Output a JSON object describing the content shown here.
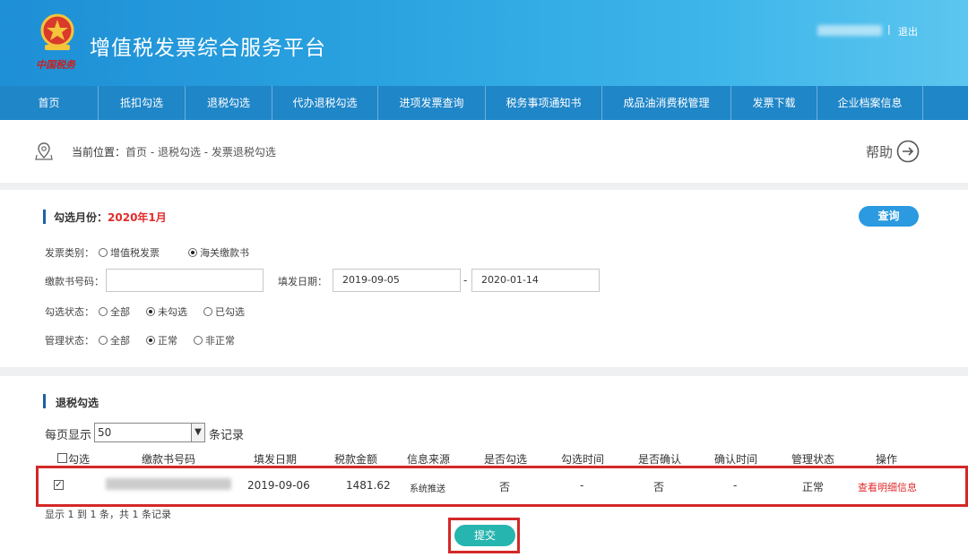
{
  "header": {
    "logo_text": "中国税务",
    "title": "增值税发票综合服务平台",
    "separator": "|",
    "logout": "退出"
  },
  "nav": {
    "items": [
      {
        "label": "首页"
      },
      {
        "label": "抵扣勾选"
      },
      {
        "label": "退税勾选"
      },
      {
        "label": "代办退税勾选"
      },
      {
        "label": "进项发票查询"
      },
      {
        "label": "税务事项通知书"
      },
      {
        "label": "成品油消费税管理"
      },
      {
        "label": "发票下载"
      },
      {
        "label": "企业档案信息"
      }
    ]
  },
  "breadcrumb": {
    "label": "当前位置：",
    "path": "首页 - 退税勾选 - 发票退税勾选",
    "help": "帮助"
  },
  "filter": {
    "month_label": "勾选月份：",
    "month_value": "2020年1月",
    "query_button": "查询",
    "invoice_type_label": "发票类别：",
    "invoice_type_options": [
      "增值税发票",
      "海关缴款书"
    ],
    "invoice_type_selected": "海关缴款书",
    "payment_no_label": "缴款书号码：",
    "payment_no_value": "",
    "issue_date_label": "填发日期：",
    "date_from": "2019-09-05",
    "date_sep": "-",
    "date_to": "2020-01-14",
    "check_status_label": "勾选状态：",
    "check_status_options": [
      "全部",
      "未勾选",
      "已勾选"
    ],
    "check_status_selected": "未勾选",
    "manage_status_label": "管理状态：",
    "manage_status_options": [
      "全部",
      "正常",
      "非正常"
    ],
    "manage_status_selected": "正常"
  },
  "table_section": {
    "title": "退税勾选",
    "per_page_label": "每页显示",
    "per_page_value": "50",
    "records_label": "条记录",
    "columns": [
      "勾选",
      "缴款书号码",
      "填发日期",
      "税款金额",
      "信息来源",
      "是否勾选",
      "勾选时间",
      "是否确认",
      "确认时间",
      "管理状态",
      "操作"
    ],
    "rows": [
      {
        "checked": true,
        "date": "2019-09-06",
        "amount": "1481.62",
        "source": "系统推送",
        "is_checked": "否",
        "check_time": "-",
        "is_confirmed": "否",
        "confirm_time": "-",
        "manage_status": "正常",
        "action": "查看明细信息"
      }
    ],
    "summary": "显示 1 到 1 条，共 1 条记录",
    "submit": "提交"
  },
  "colors": {
    "header_blue": "#2aa3e0",
    "nav_blue": "#1f86c8",
    "accent_red": "#e12c2c",
    "submit_teal": "#27b5b0"
  }
}
